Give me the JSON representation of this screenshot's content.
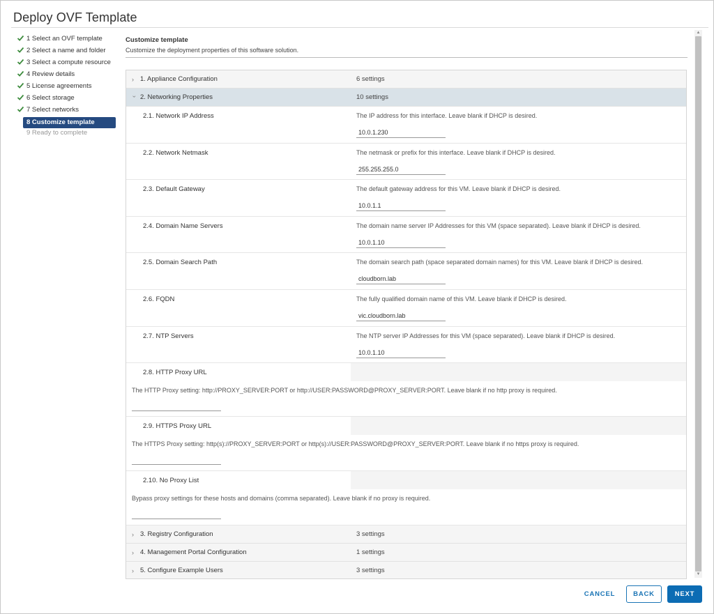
{
  "dialog": {
    "title": "Deploy OVF Template"
  },
  "steps": [
    {
      "label": "1 Select an OVF template",
      "state": "done"
    },
    {
      "label": "2 Select a name and folder",
      "state": "done"
    },
    {
      "label": "3 Select a compute resource",
      "state": "done"
    },
    {
      "label": "4 Review details",
      "state": "done"
    },
    {
      "label": "5 License agreements",
      "state": "done"
    },
    {
      "label": "6 Select storage",
      "state": "done"
    },
    {
      "label": "7 Select networks",
      "state": "done"
    },
    {
      "label": "8 Customize template",
      "state": "active"
    },
    {
      "label": "9 Ready to complete",
      "state": "disabled"
    }
  ],
  "header": {
    "title": "Customize template",
    "subtitle": "Customize the deployment properties of this software solution."
  },
  "groups": [
    {
      "name": "1. Appliance Configuration",
      "count": "6 settings"
    },
    {
      "name": "2. Networking Properties",
      "count": "10 settings"
    },
    {
      "name": "3. Registry Configuration",
      "count": "3 settings"
    },
    {
      "name": "4. Management Portal Configuration",
      "count": "1 settings"
    },
    {
      "name": "5. Configure Example Users",
      "count": "3 settings"
    }
  ],
  "properties": [
    {
      "name": "2.1. Network IP Address",
      "desc": "The IP address for this interface. Leave blank if DHCP is desired.",
      "value": "10.0.1.230"
    },
    {
      "name": "2.2. Network Netmask",
      "desc": "The netmask or prefix for this interface. Leave blank if DHCP is desired.",
      "value": "255.255.255.0"
    },
    {
      "name": "2.3. Default Gateway",
      "desc": "The default gateway address for this VM. Leave blank if DHCP is desired.",
      "value": "10.0.1.1"
    },
    {
      "name": "2.4. Domain Name Servers",
      "desc": "The domain name server IP Addresses for this VM (space separated). Leave blank if DHCP is desired.",
      "value": "10.0.1.10"
    },
    {
      "name": "2.5. Domain Search Path",
      "desc": "The domain search path (space separated domain names) for this VM. Leave blank if DHCP is desired.",
      "value": "cloudborn.lab"
    },
    {
      "name": "2.6. FQDN",
      "desc": "The fully qualified domain name of this VM. Leave blank if DHCP is desired.",
      "value": "vic.cloudborn.lab"
    },
    {
      "name": "2.7. NTP Servers",
      "desc": "The NTP server IP Addresses for this VM (space separated). Leave blank if DHCP is desired.",
      "value": "10.0.1.10"
    },
    {
      "name": "2.8. HTTP Proxy URL",
      "desc": "The HTTP Proxy setting: http://PROXY_SERVER:PORT or http://USER:PASSWORD@PROXY_SERVER:PORT. Leave blank if no http proxy is required.",
      "value": ""
    },
    {
      "name": "2.9. HTTPS Proxy URL",
      "desc": "The HTTPS Proxy setting: http(s)://PROXY_SERVER:PORT or http(s)://USER:PASSWORD@PROXY_SERVER:PORT. Leave blank if no https proxy is required.",
      "value": ""
    },
    {
      "name": "2.10. No Proxy List",
      "desc": "Bypass proxy settings for these hosts and domains (comma separated). Leave blank if no proxy is required.",
      "value": ""
    }
  ],
  "buttons": {
    "cancel": "CANCEL",
    "back": "BACK",
    "next": "NEXT"
  },
  "colors": {
    "accent": "#0c6cb4",
    "active_step": "#254a80",
    "check": "#3c8b3c"
  }
}
